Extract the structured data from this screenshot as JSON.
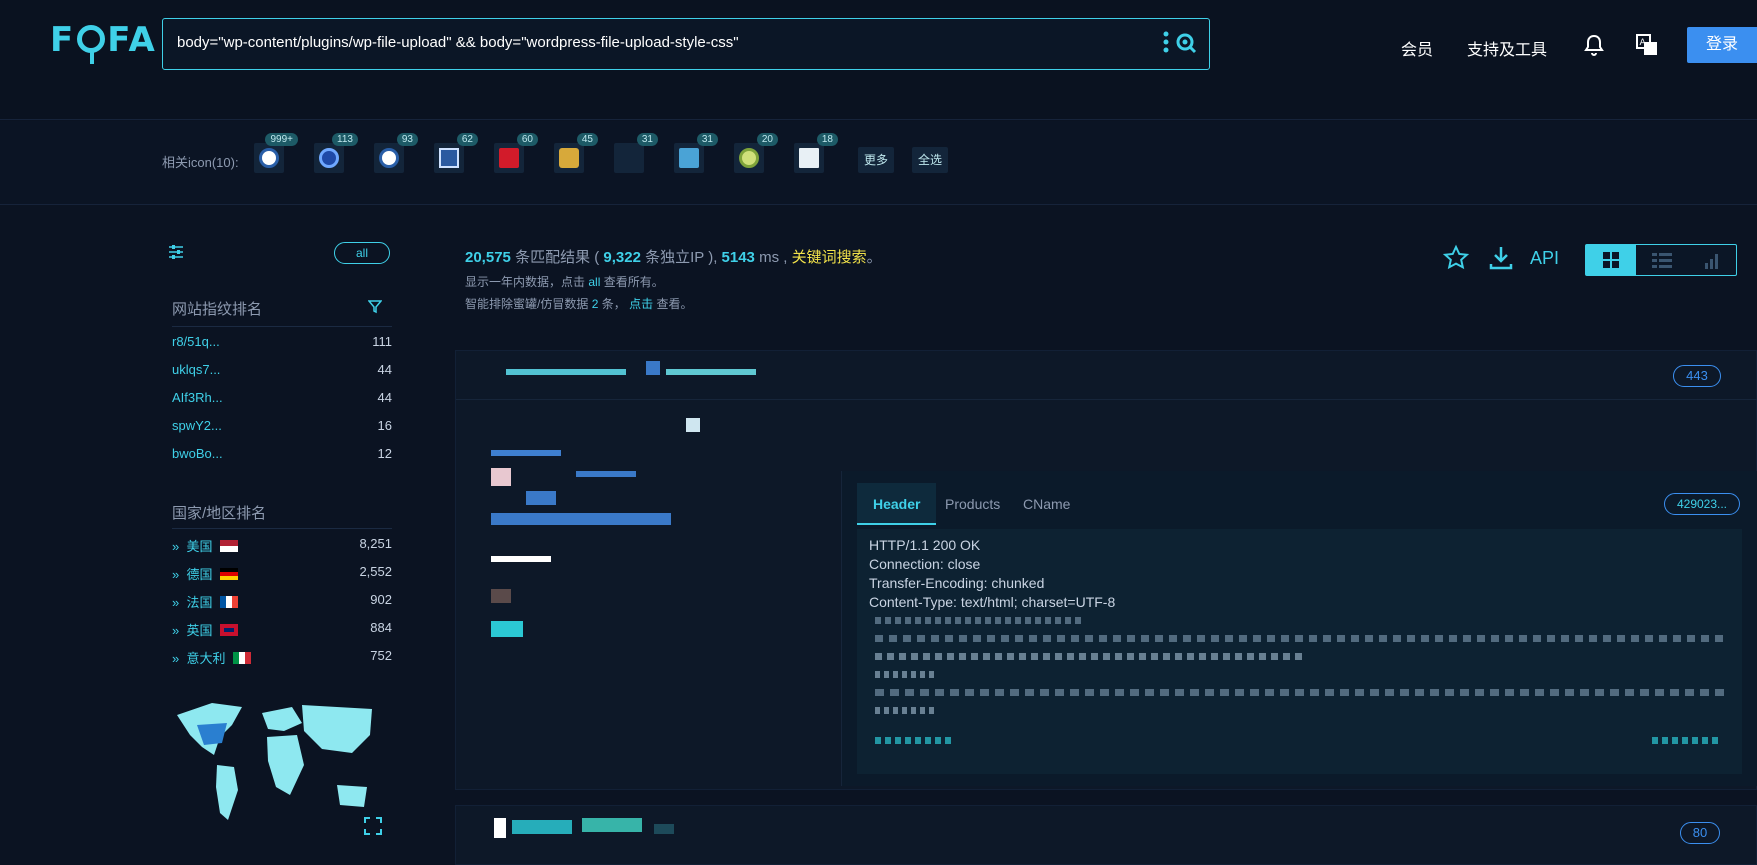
{
  "logo": "FOFA",
  "search": {
    "query": "body=\"wp-content/plugins/wp-file-upload\" && body=\"wordpress-file-upload-style-css\""
  },
  "nav": {
    "member": "会员",
    "tools": "支持及工具",
    "login": "登录"
  },
  "icon_bar": {
    "label": "相关icon(10):",
    "icons": [
      {
        "badge": "999+"
      },
      {
        "badge": "113"
      },
      {
        "badge": "93"
      },
      {
        "badge": "62"
      },
      {
        "badge": "60"
      },
      {
        "badge": "45"
      },
      {
        "badge": "31"
      },
      {
        "badge": "31"
      },
      {
        "badge": "20"
      },
      {
        "badge": "18"
      }
    ],
    "more": "更多",
    "select_all": "全选"
  },
  "sidebar": {
    "all_pill": "all",
    "fingerprint_title": "网站指纹排名",
    "fingerprints": [
      {
        "name": "r8/51q...",
        "count": "111"
      },
      {
        "name": "uklqs7...",
        "count": "44"
      },
      {
        "name": "AIf3Rh...",
        "count": "44"
      },
      {
        "name": "spwY2...",
        "count": "16"
      },
      {
        "name": "bwoBo...",
        "count": "12"
      }
    ],
    "country_title": "国家/地区排名",
    "countries": [
      {
        "name": "美国",
        "count": "8,251",
        "flag": "us"
      },
      {
        "name": "德国",
        "count": "2,552",
        "flag": "de"
      },
      {
        "name": "法国",
        "count": "902",
        "flag": "fr"
      },
      {
        "name": "英国",
        "count": "884",
        "flag": "gb"
      },
      {
        "name": "意大利",
        "count": "752",
        "flag": "it"
      }
    ]
  },
  "results": {
    "total": "20,575",
    "total_label": "条匹配结果 (",
    "unique_ip": "9,322",
    "unique_label": "条独立IP ),",
    "time": "5143",
    "time_unit": "ms ,",
    "keyword_search": "关键词搜索",
    "keyword_tail": "。",
    "note1_pre": "显示一年内数据，点击",
    "note1_link": "all",
    "note1_post": "查看所有。",
    "note2_pre": "智能排除蜜罐/仿冒数据",
    "note2_count": "2",
    "note2_mid": "条，",
    "note2_link": "点击",
    "note2_post": "查看。",
    "api_label": "API"
  },
  "card1": {
    "port": "443",
    "tabs": [
      "Header",
      "Products",
      "CName"
    ],
    "hash": "429023...",
    "header_lines": [
      "HTTP/1.1 200 OK",
      "Connection: close",
      "Transfer-Encoding: chunked",
      "Content-Type: text/html; charset=UTF-8"
    ]
  },
  "card2": {
    "port": "80"
  },
  "colors": {
    "accent": "#3fd0e8",
    "keyword": "#f2e24a",
    "login_bg": "#3b8ff0",
    "background": "#0b1322"
  }
}
